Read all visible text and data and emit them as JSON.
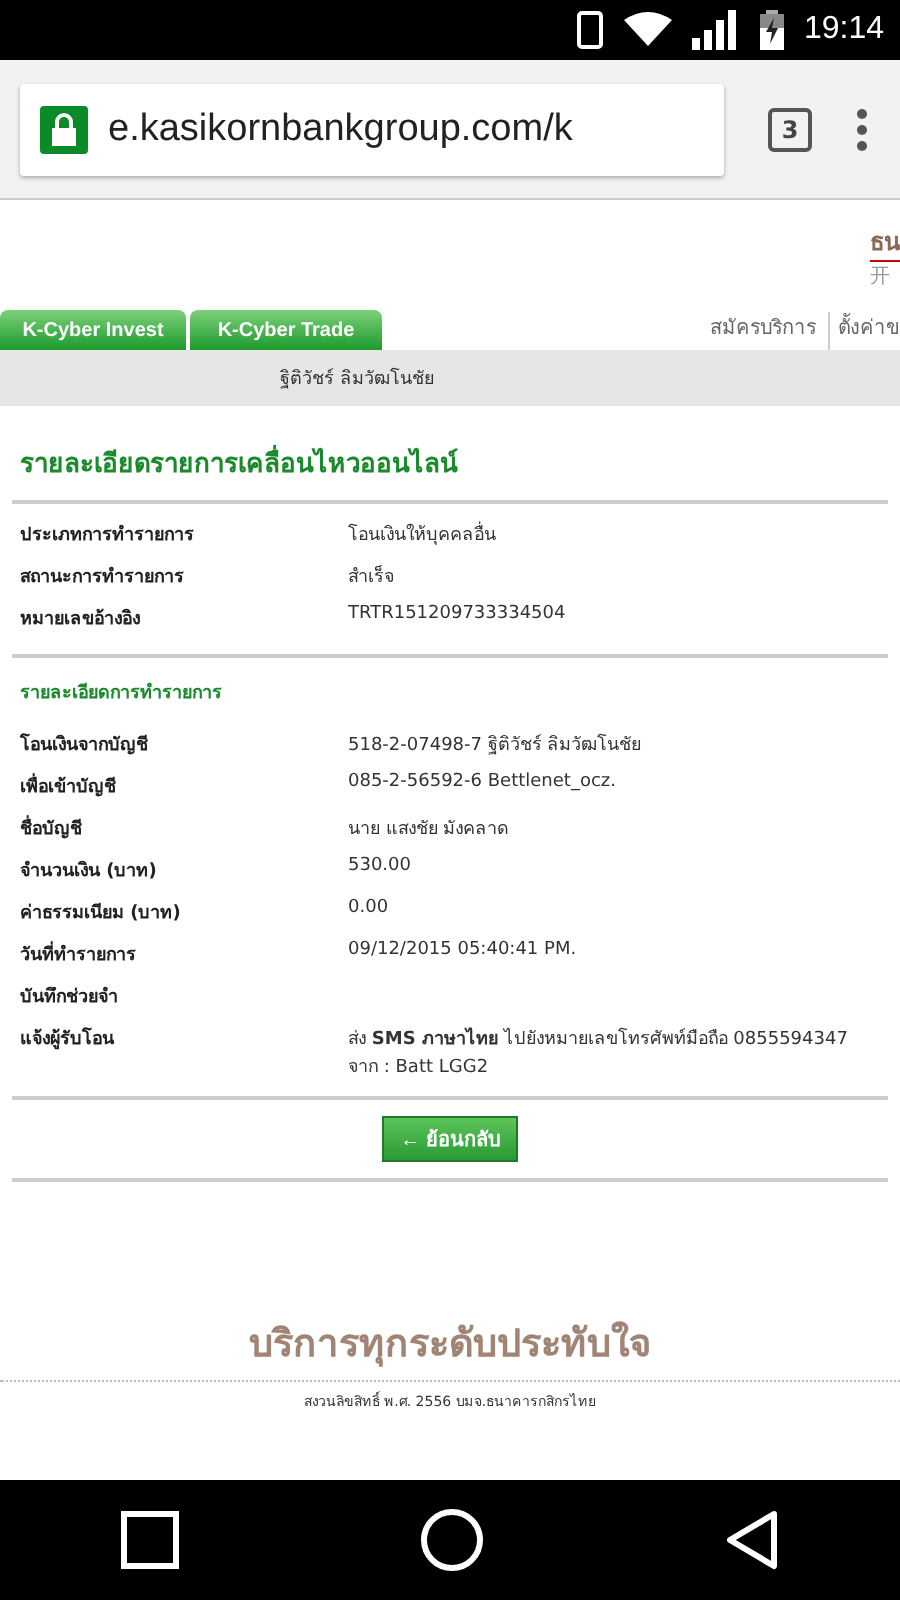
{
  "status_bar": {
    "time": "19:14"
  },
  "browser": {
    "url": "e.kasikornbankgroup.com/k",
    "tab_count": "3"
  },
  "header": {
    "logo": "ธน",
    "logo_sub": "开"
  },
  "tabs": [
    {
      "label": "K-Cyber Invest"
    },
    {
      "label": "K-Cyber Trade"
    }
  ],
  "top_links": [
    "สมัครบริการ",
    "ตั้งค่าข"
  ],
  "user_name": "ฐิติวัชร์ ลิมวัฒโนชัย",
  "title": "รายละเอียดรายการเคลื่อนไหวออนไลน์",
  "summary": [
    {
      "label": "ประเภทการทำรายการ",
      "value": "โอนเงินให้บุคคลอื่น"
    },
    {
      "label": "สถานะการทำรายการ",
      "value": "สำเร็จ"
    },
    {
      "label": "หมายเลขอ้างอิง",
      "value": "TRTR151209733334504"
    }
  ],
  "details_title": "รายละเอียดการทำรายการ",
  "details": [
    {
      "label": "โอนเงินจากบัญชี",
      "lines": [
        "518-2-07498-7 ฐิติวัชร์ ลิมวัฒโนชัย"
      ]
    },
    {
      "label": "เพื่อเข้าบัญชี",
      "lines": [
        "085-2-56592-6 Bettlenet_ocz."
      ]
    },
    {
      "label": "ชื่อบัญชี",
      "lines": [
        "นาย แสงชัย มังคลาด"
      ]
    },
    {
      "label": "จำนวนเงิน (บาท)",
      "lines": [
        "530.00"
      ]
    },
    {
      "label": "ค่าธรรมเนียม (บาท)",
      "lines": [
        "0.00"
      ]
    },
    {
      "label": "วันที่ทำรายการ",
      "lines": [
        "09/12/2015 05:40:41 PM."
      ]
    },
    {
      "label": "บันทึกช่วยจำ"
    },
    {
      "label": "แจ้งผู้รับโอน",
      "lines": [
        "ส่ง **SMS ภาษาไทย** ไปยังหมายเลขโทรศัพท์มือถือ 0855594347",
        "จาก : Batt LGG2"
      ]
    }
  ],
  "back_button": "← ย้อนกลับ",
  "footer": {
    "slogan": "บริการทุกระดับประทับใจ",
    "copyright": "สงวนลิขสิทธิ์ พ.ศ. 2556 บมจ.ธนาคารกสิกรไทย"
  }
}
